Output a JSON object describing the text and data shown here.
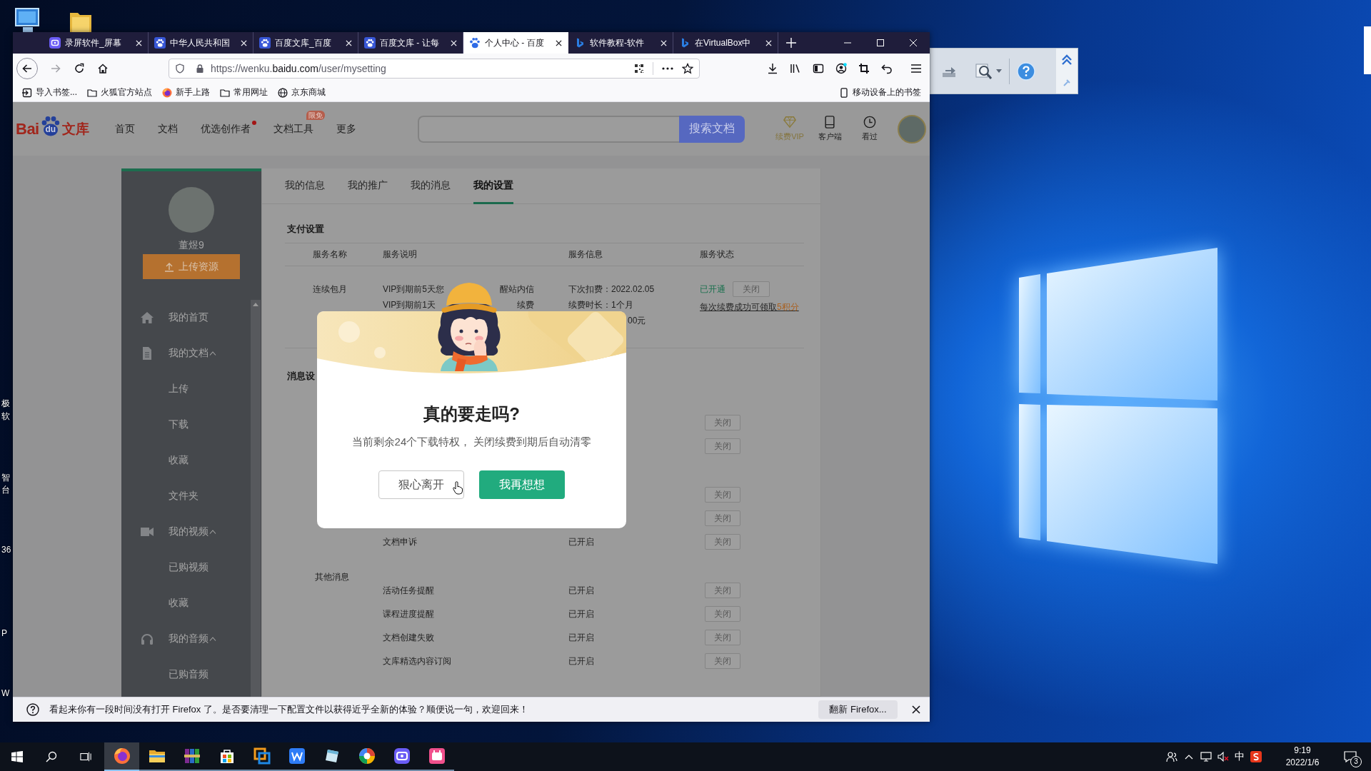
{
  "desktop": {
    "edge_labels": [
      "极",
      "软",
      "智",
      "台",
      "36",
      "P",
      "W"
    ]
  },
  "browser": {
    "tabs": [
      {
        "kind": "recorder",
        "title": "录屏软件_屏幕",
        "selected": false
      },
      {
        "kind": "baidu",
        "title": "中华人民共和国",
        "selected": false
      },
      {
        "kind": "baidu",
        "title": "百度文库_百度",
        "selected": false
      },
      {
        "kind": "baidu",
        "title": "百度文库 - 让每",
        "selected": false
      },
      {
        "kind": "paw",
        "title": "个人中心 - 百度",
        "selected": true
      },
      {
        "kind": "bing",
        "title": "软件教程-软件",
        "selected": false
      },
      {
        "kind": "bing",
        "title": "在VirtualBox中",
        "selected": false
      }
    ],
    "address": {
      "prefix": "https://wenku.",
      "domain": "baidu.com",
      "path": "/user/mysetting"
    },
    "bookmarks": [
      {
        "kind": "import",
        "label": "导入书签..."
      },
      {
        "kind": "folder",
        "label": "火狐官方站点"
      },
      {
        "kind": "firefox",
        "label": "新手上路"
      },
      {
        "kind": "folder",
        "label": "常用网址"
      },
      {
        "kind": "globe",
        "label": "京东商城"
      }
    ],
    "mobile_bookmarks": "移动设备上的书签",
    "notification": {
      "text": "看起来你有一段时间没有打开 Firefox 了。是否要清理一下配置文件以获得近乎全新的体验？顺便说一句，欢迎回来！",
      "button": "翻新 Firefox..."
    }
  },
  "page": {
    "logo": {
      "left": "Bai",
      "mark": "du",
      "right": "文库"
    },
    "nav": [
      {
        "label": "首页",
        "dot": false
      },
      {
        "label": "文档",
        "dot": false
      },
      {
        "label": "优选创作者",
        "dot": true
      },
      {
        "label": "文档工具",
        "dot": false,
        "badge": "限免"
      },
      {
        "label": "更多",
        "dot": false
      }
    ],
    "search_button": "搜索文档",
    "actions": [
      {
        "kind": "vip",
        "label": "续费VIP"
      },
      {
        "kind": "client",
        "label": "客户端"
      },
      {
        "kind": "history",
        "label": "看过"
      }
    ],
    "sidebar": {
      "username": "董煜9",
      "upload": "上传资源",
      "menu": [
        {
          "kind": "home",
          "label": "我的首页"
        },
        {
          "kind": "document",
          "label": "我的文档",
          "expanded": true,
          "children": [
            {
              "label": "上传"
            },
            {
              "label": "下载"
            },
            {
              "label": "收藏"
            },
            {
              "label": "文件夹"
            }
          ]
        },
        {
          "kind": "video",
          "label": "我的视频",
          "expanded": true,
          "children": [
            {
              "label": "已购视频"
            },
            {
              "label": "收藏"
            }
          ]
        },
        {
          "kind": "headphones",
          "label": "我的音频",
          "expanded": true,
          "children": [
            {
              "label": "已购音频"
            }
          ]
        }
      ]
    },
    "tabs": [
      {
        "label": "我的信息",
        "selected": false
      },
      {
        "label": "我的推广",
        "selected": false
      },
      {
        "label": "我的消息",
        "selected": false
      },
      {
        "label": "我的设置",
        "selected": true
      }
    ],
    "payment": {
      "title": "支付设置",
      "columns": [
        "服务名称",
        "服务说明",
        "服务信息",
        "服务状态"
      ],
      "rows": [
        {
          "name": "连续包月",
          "description": [
            {
              "start": "VIP到期前5天您",
              "end": "醒站内信"
            },
            {
              "start": "VIP到期前1天",
              "end": "续费"
            }
          ],
          "info": [
            "下次扣费：2022.02.05",
            "续费时长：1个月"
          ],
          "info_fragment": "00元",
          "status": "已开通",
          "button": "关闭",
          "reward": "每次续费成功可领取",
          "reward_points": "5积分"
        }
      ]
    },
    "messages": {
      "title": "消息设",
      "groups": [
        {
          "rows": [
            {
              "button": "关闭"
            },
            {
              "button": "关闭"
            }
          ]
        },
        {
          "rows": [
            {
              "button": "关闭"
            },
            {
              "button": "关闭"
            },
            {
              "name": "文档申诉",
              "status": "已开启",
              "button": "关闭"
            }
          ]
        },
        {
          "title": "其他消息",
          "rows": [
            {
              "name": "活动任务提醒",
              "status": "已开启",
              "button": "关闭"
            },
            {
              "name": "课程进度提醒",
              "status": "已开启",
              "button": "关闭"
            },
            {
              "name": "文档创建失败",
              "status": "已开启",
              "button": "关闭"
            },
            {
              "name": "文库精选内容订阅",
              "status": "已开启",
              "button": "关闭"
            }
          ]
        }
      ]
    }
  },
  "dialog": {
    "title": "真的要走吗?",
    "message": "当前剩余24个下载特权， 关闭续费到期后自动清零",
    "buttons": [
      {
        "kind": "secondary",
        "label": "狠心离开"
      },
      {
        "kind": "primary",
        "label": "我再想想"
      }
    ]
  },
  "taskbar": {
    "apps": [
      {
        "kind": "firefox",
        "selected": true
      },
      {
        "kind": "folder",
        "selected": false
      },
      {
        "kind": "archive",
        "selected": false
      },
      {
        "kind": "store",
        "selected": false
      },
      {
        "kind": "squares",
        "selected": false
      },
      {
        "kind": "wps",
        "selected": false
      },
      {
        "kind": "note",
        "selected": false
      },
      {
        "kind": "pinwheel",
        "selected": false
      },
      {
        "kind": "recorder",
        "selected": false
      },
      {
        "kind": "calendar",
        "selected": false
      }
    ],
    "ime": "中",
    "time": "9:19",
    "date": "2022/1/6",
    "notification_count": "3"
  }
}
